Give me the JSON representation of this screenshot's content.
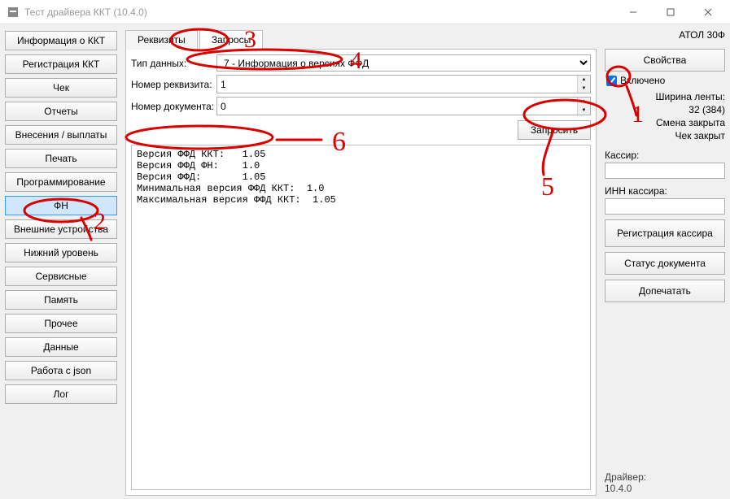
{
  "window": {
    "title": "Тест драйвера ККТ (10.4.0)"
  },
  "left_nav": {
    "items": [
      "Информация о ККТ",
      "Регистрация ККТ",
      "Чек",
      "Отчеты",
      "Внесения / выплаты",
      "Печать",
      "Программирование",
      "ФН",
      "Внешние устройства",
      "Нижний уровень",
      "Сервисные",
      "Память",
      "Прочее",
      "Данные",
      "Работа с json",
      "Лог"
    ],
    "selected_index": 7
  },
  "tabs": {
    "items": [
      "Реквизиты",
      "Запросы"
    ],
    "active_index": 1
  },
  "form": {
    "data_type_label": "Тип данных:",
    "data_type_value": "7 - Информация о версиях ФФД",
    "req_number_label": "Номер реквизита:",
    "req_number_value": "1",
    "doc_number_label": "Номер документа:",
    "doc_number_value": "0",
    "request_btn": "Запросить"
  },
  "output_text": "Версия ФФД ККТ:   1.05\nВерсия ФФД ФН:    1.0\nВерсия ФФД:       1.05\nМинимальная версия ФФД ККТ:  1.0\nМаксимальная версия ФФД ККТ:  1.05",
  "right": {
    "device": "АТОЛ 30Ф",
    "properties_btn": "Свойства",
    "enabled_label": "Включено",
    "enabled_checked": true,
    "tape_width_label": "Ширина ленты:",
    "tape_width_value": "32 (384)",
    "shift_status": "Смена закрыта",
    "check_status": "Чек закрыт",
    "cashier_label": "Кассир:",
    "cashier_value": "",
    "inn_label": "ИНН кассира:",
    "inn_value": "",
    "reg_cashier_btn": "Регистрация кассира",
    "doc_status_btn": "Статус документа",
    "print_more_btn": "Допечатать",
    "driver_label": "Драйвер:",
    "driver_version": "10.4.0"
  },
  "annotations": {
    "color": "#d90000",
    "marks": [
      "1",
      "2",
      "3",
      "4",
      "5",
      "6"
    ]
  }
}
